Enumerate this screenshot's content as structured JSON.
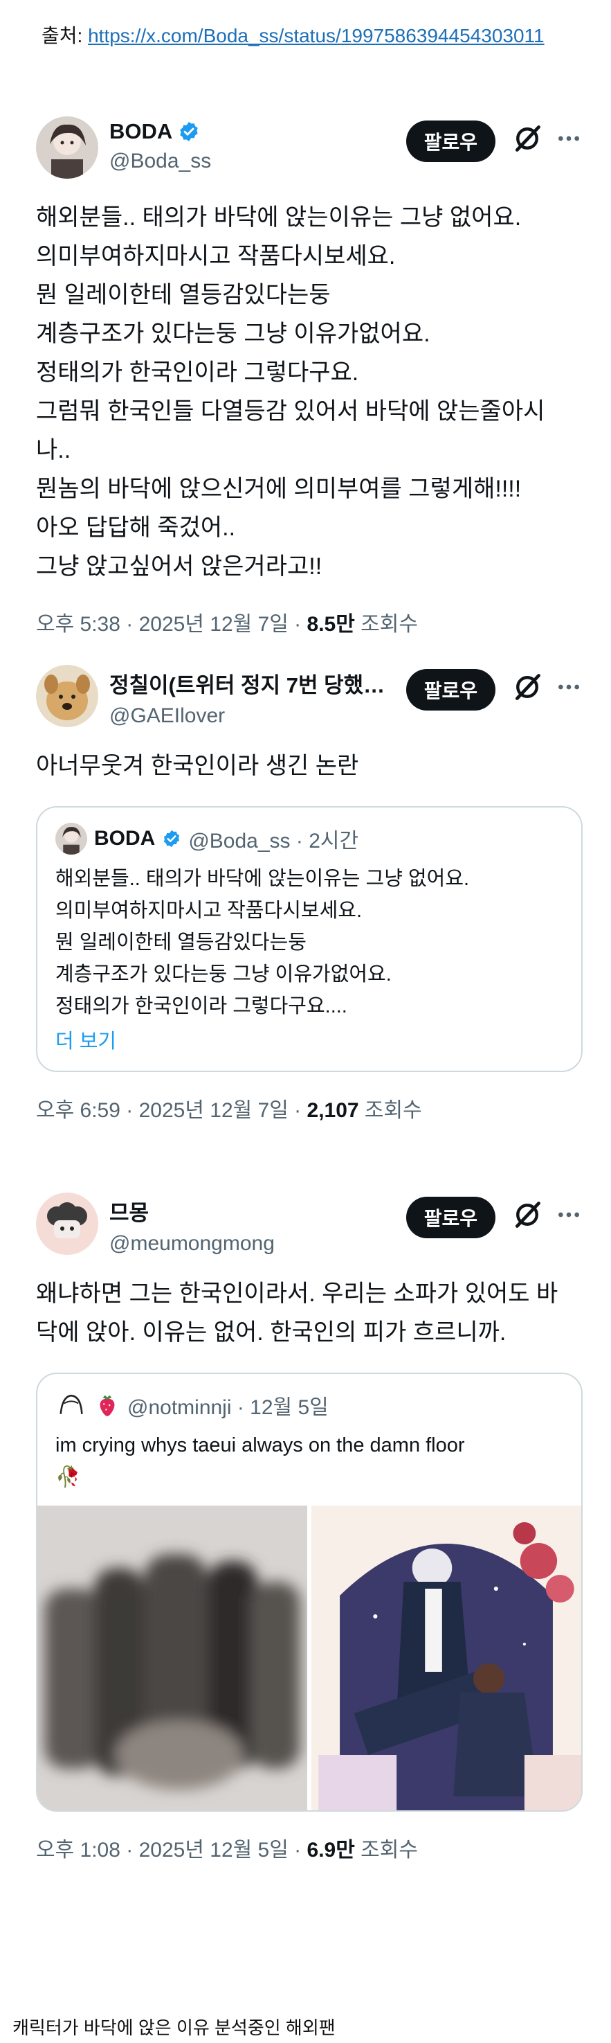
{
  "source": {
    "label": "출처: ",
    "url": "https://x.com/Boda_ss/status/1997586394454303011"
  },
  "tweets": [
    {
      "display_name": "BODA",
      "handle": "@Boda_ss",
      "follow_label": "팔로우",
      "text": "해외분들.. 태의가 바닥에 앉는이유는 그냥 없어요.\n의미부여하지마시고 작품다시보세요.\n뭔 일레이한테 열등감있다는둥\n계층구조가 있다는둥 그냥 이유가없어요.\n정태의가 한국인이라 그렇다구요.\n그럼뭐 한국인들 다열등감 있어서 바닥에 앉는줄아시\n나..\n뭔놈의 바닥에 앉으신거에 의미부여를 그렇게해!!!!\n아오 답답해 죽겄어..\n그냥 앉고싶어서 앉은거라고!!",
      "time": "오후 5:38 · 2025년 12월 7일 · ",
      "views": "8.5만",
      "views_label": " 조회수"
    },
    {
      "display_name": "정칠이(트위터 정지 7번 당했…",
      "handle": "@GAEIlover",
      "follow_label": "팔로우",
      "text": "아너무웃겨 한국인이라 생긴 논란",
      "quote": {
        "name": "BODA",
        "handle": "@Boda_ss · 2시간",
        "text": "해외분들.. 태의가 바닥에 앉는이유는 그냥 없어요.\n의미부여하지마시고 작품다시보세요.\n뭔 일레이한테 열등감있다는둥\n계층구조가 있다는둥 그냥 이유가없어요.\n정태의가 한국인이라 그렇다구요....",
        "show_more": "더 보기"
      },
      "time": "오후 6:59 · 2025년 12월 7일 · ",
      "views": "2,107",
      "views_label": " 조회수"
    },
    {
      "display_name": "므몽",
      "handle": "@meumongmong",
      "follow_label": "팔로우",
      "text": "왜냐하면 그는 한국인이라서. 우리는 소파가 있어도 바\n닥에 앉아. 이유는 없어. 한국인의 피가 흐르니까.",
      "quote": {
        "handle": "@notminnji · 12월 5일",
        "text": "im crying whys taeui always on the damn floor\n🥀"
      },
      "time": "오후 1:08 · 2025년 12월 5일 · ",
      "views": "6.9만",
      "views_label": " 조회수"
    }
  ],
  "caption": "캐릭터가 바닥에 앉은 이유 분석중인 해외팬",
  "colors": {
    "accent": "#1d9bf0",
    "text": "#0f1419",
    "muted": "#536471",
    "border": "#cfd9de"
  }
}
